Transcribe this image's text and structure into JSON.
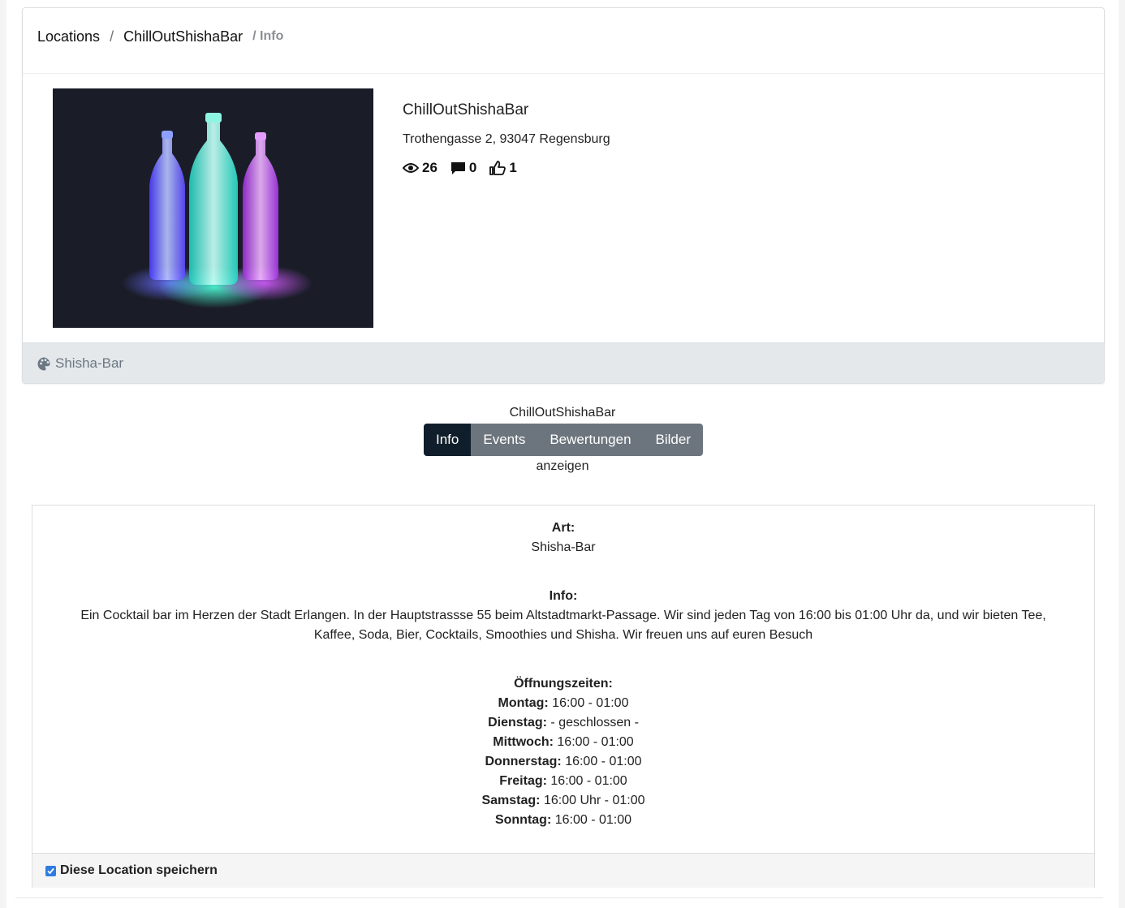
{
  "breadcrumb": {
    "items": [
      "Locations",
      "ChillOutShishaBar"
    ],
    "separator": "/",
    "active": "/ Info"
  },
  "location": {
    "name": "ChillOutShishaBar",
    "address": "Trothengasse 2, 93047 Regensburg",
    "stats": {
      "views": "26",
      "comments": "0",
      "likes": "1"
    },
    "category": "Shisha-Bar"
  },
  "tabs": {
    "caption_top": "ChillOutShishaBar",
    "caption_bottom": "anzeigen",
    "items": [
      "Info",
      "Events",
      "Bewertungen",
      "Bilder"
    ],
    "active": "Info"
  },
  "details": {
    "art_label": "Art:",
    "art_value": "Shisha-Bar",
    "info_label": "Info:",
    "info_line1": "Ein Cocktail bar im Herzen der Stadt Erlangen. In der Hauptstrassse 55 beim Altstadtmarkt-Passage. Wir sind jeden Tag von 16:00 bis 01:00 Uhr da, und wir bieten Tee,",
    "info_line2": "Kaffee, Soda, Bier, Cocktails, Smoothies und Shisha. Wir freuen uns auf euren Besuch",
    "hours_label": "Öffnungszeiten:",
    "hours": [
      {
        "day": "Montag:",
        "time": "16:00 - 01:00"
      },
      {
        "day": "Dienstag:",
        "time": "- geschlossen -"
      },
      {
        "day": "Mittwoch:",
        "time": "16:00 - 01:00"
      },
      {
        "day": "Donnerstag:",
        "time": "16:00 - 01:00"
      },
      {
        "day": "Freitag:",
        "time": "16:00 - 01:00"
      },
      {
        "day": "Samstag:",
        "time": "16:00 Uhr - 01:00"
      },
      {
        "day": "Sonntag:",
        "time": "16:00 - 01:00"
      }
    ]
  },
  "save": {
    "label": "Diese Location speichern",
    "checked": true
  },
  "colors": {
    "tab_active": "#0f1e2a",
    "tab_inactive": "#6c757d",
    "card_footer": "#e4e8ea",
    "checkbox": "#2f7ce0"
  },
  "icons": {
    "views": "eye-icon",
    "comments": "comment-icon",
    "likes": "thumbs-up-icon",
    "category": "palette-icon",
    "save": "checkbox-checked-icon"
  }
}
